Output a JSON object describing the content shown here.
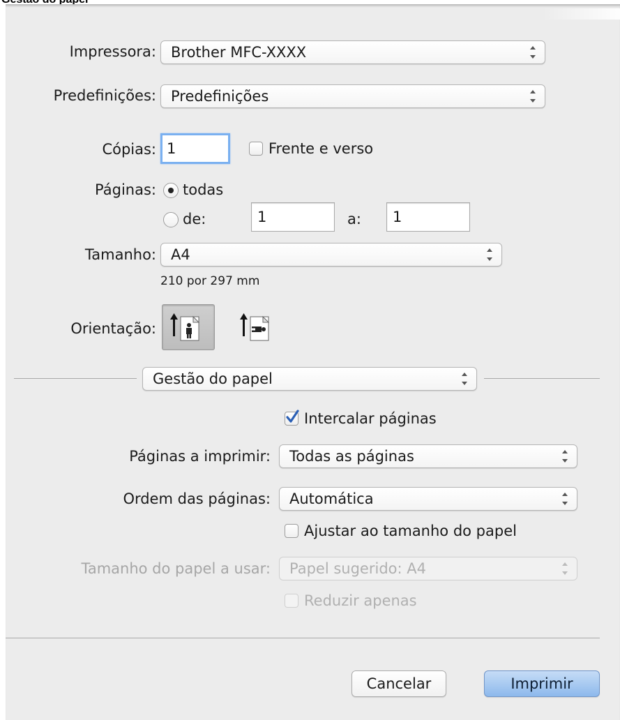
{
  "caption": "Gestão do papel",
  "printer": {
    "label": "Impressora:",
    "value": "Brother MFC-XXXX"
  },
  "presets": {
    "label": "Predefinições:",
    "value": "Predefinições"
  },
  "copies": {
    "label": "Cópias:",
    "value": "1",
    "duplex_label": "Frente e verso"
  },
  "pages": {
    "label": "Páginas:",
    "all_label": "todas",
    "from_label": "de:",
    "from_value": "1",
    "to_label": "a:",
    "to_value": "1"
  },
  "paper_size": {
    "label": "Tamanho:",
    "value": "A4",
    "dimensions": "210 por 297 mm"
  },
  "orientation": {
    "label": "Orientação:",
    "selected": "portrait"
  },
  "section_popup": {
    "value": "Gestão do papel"
  },
  "paper_handling": {
    "collate_label": "Intercalar páginas",
    "collate_checked": true,
    "pages_to_print": {
      "label": "Páginas a imprimir:",
      "value": "Todas as páginas"
    },
    "page_order": {
      "label": "Ordem das páginas:",
      "value": "Automática"
    },
    "scale_label": "Ajustar ao tamanho do papel",
    "destination_size": {
      "label": "Tamanho do papel a usar:",
      "value": "Papel sugerido: A4"
    },
    "scale_down_label": "Reduzir apenas"
  },
  "buttons": {
    "cancel": "Cancelar",
    "print": "Imprimir"
  },
  "colors": {
    "accent": "#8db9ec",
    "focus_ring": "#7ab0f0",
    "panel_bg": "#ececec"
  }
}
